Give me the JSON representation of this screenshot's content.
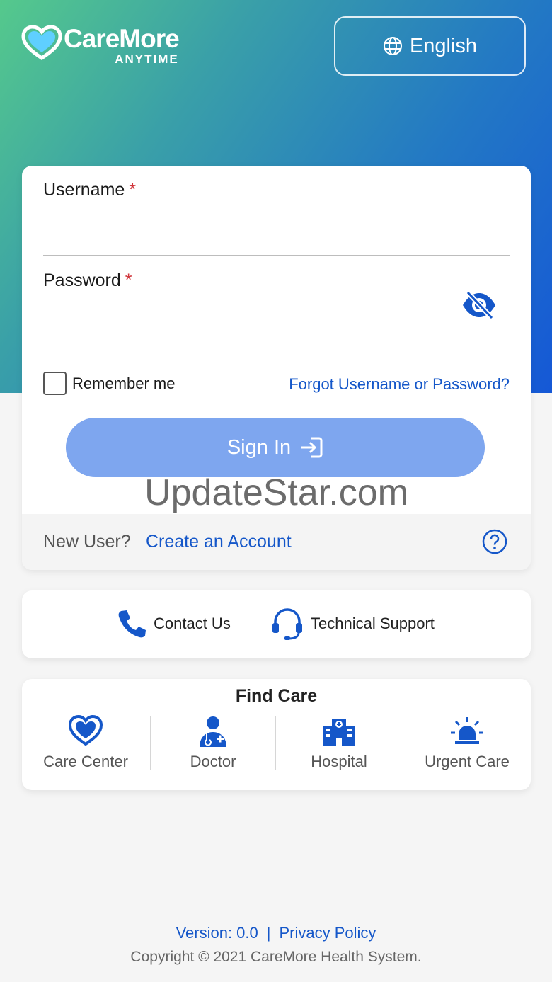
{
  "brand": {
    "name": "CareMore",
    "sub": "ANYTIME"
  },
  "language": {
    "label": "English"
  },
  "login": {
    "username_label": "Username",
    "password_label": "Password",
    "required_mark": "*",
    "username_value": "",
    "password_value": "",
    "remember_label": "Remember me",
    "remember_checked": false,
    "forgot_label": "Forgot Username or Password?",
    "signin_label": "Sign In"
  },
  "watermark": "UpdateStar.com",
  "new_user": {
    "question": "New User?",
    "create_label": "Create an Account"
  },
  "support": {
    "contact_label": "Contact Us",
    "tech_label": "Technical Support"
  },
  "find_care": {
    "title": "Find Care",
    "items": [
      {
        "label": "Care Center",
        "icon": "heart-icon"
      },
      {
        "label": "Doctor",
        "icon": "doctor-icon"
      },
      {
        "label": "Hospital",
        "icon": "hospital-icon"
      },
      {
        "label": "Urgent Care",
        "icon": "siren-icon"
      }
    ]
  },
  "footer": {
    "version": "Version: 0.0",
    "separator": "|",
    "privacy": "Privacy Policy",
    "copyright": "Copyright © 2021 CareMore Health System."
  },
  "colors": {
    "accent": "#1557c9",
    "signin": "#7ea6ef",
    "required": "#d0343a"
  }
}
